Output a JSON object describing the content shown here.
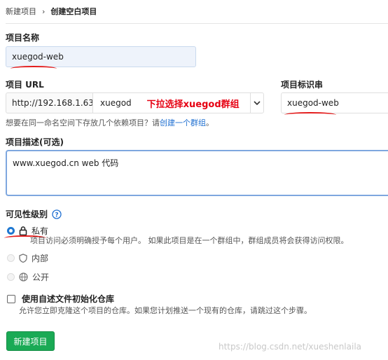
{
  "breadcrumb": {
    "parent": "新建项目",
    "separator": "›",
    "current": "创建空白项目"
  },
  "project_name": {
    "label": "项目名称",
    "value": "xuegod-web"
  },
  "project_url": {
    "label": "项目 URL",
    "prefix": "http://192.168.1.63/",
    "namespace": "xuegod",
    "annotation": "下拉选择xuegod群组"
  },
  "project_slug": {
    "label": "项目标识串",
    "value": "xuegod-web"
  },
  "url_hint": {
    "text": "想要在同一命名空间下存放几个依赖项目？请",
    "link": "创建一个群组",
    "suffix": "。"
  },
  "description": {
    "label": "项目描述(可选)",
    "value": "www.xuegod.cn web 代码"
  },
  "visibility": {
    "label": "可见性级别",
    "options": [
      {
        "label": "私有",
        "desc": "项目访问必须明确授予每个用户。 如果此项目是在一个群组中，群组成员将会获得访问权限。",
        "selected": true
      },
      {
        "label": "内部",
        "selected": false
      },
      {
        "label": "公开",
        "selected": false
      }
    ]
  },
  "init_readme": {
    "label": "使用自述文件初始化仓库",
    "desc": "允许您立即克隆这个项目的仓库。如果您计划推送一个现有的仓库，请跳过这个步骤。"
  },
  "submit": {
    "label": "新建项目"
  },
  "watermark": "https://blog.csdn.net/xueshenlaila",
  "colors": {
    "accent": "#1aaa55",
    "link": "#1f6fd1",
    "annotation": "#e60012",
    "radio_selected": "#1f78d1"
  }
}
